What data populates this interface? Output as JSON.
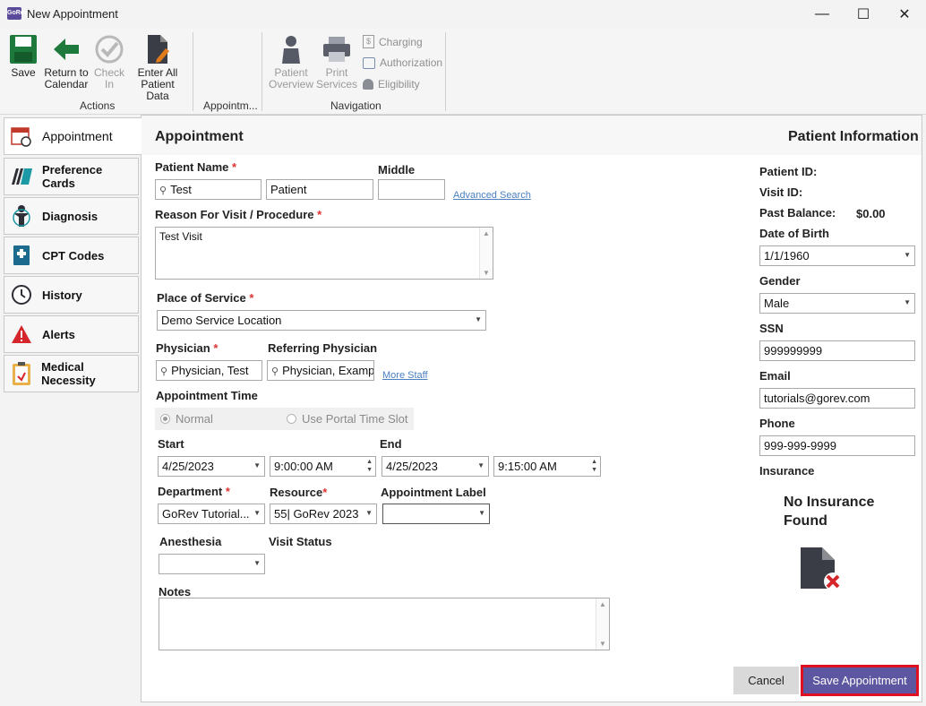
{
  "window": {
    "title": "New Appointment",
    "app_icon_text": "GoRev",
    "minimize_glyph": "—",
    "maximize_glyph": "☐",
    "close_glyph": "✕"
  },
  "ribbon": {
    "save": "Save",
    "return_line1": "Return to",
    "return_line2": "Calendar",
    "checkin_line1": "Check",
    "checkin_line2": "In",
    "enter_line1": "Enter All",
    "enter_line2": "Patient Data",
    "group_actions": "Actions",
    "group_appointment": "Appointm...",
    "overview_line1": "Patient",
    "overview_line2": "Overview",
    "print_line1": "Print",
    "print_line2": "Services",
    "charging": "Charging",
    "authorization": "Authorization",
    "eligibility": "Eligibility",
    "group_navigation": "Navigation"
  },
  "tabs": [
    {
      "label": "Appointment",
      "icon": "calendar-clock-icon"
    },
    {
      "label": "Preference Cards",
      "icon": "cards-icon"
    },
    {
      "label": "Diagnosis",
      "icon": "body-icon"
    },
    {
      "label": "CPT Codes",
      "icon": "book-icon"
    },
    {
      "label": "History",
      "icon": "clock-icon"
    },
    {
      "label": "Alerts",
      "icon": "warning-icon"
    },
    {
      "label": "Medical Necessity",
      "icon": "clipboard-icon"
    }
  ],
  "form": {
    "section_title": "Appointment",
    "patient_name_label": "Patient Name",
    "middle_label": "Middle",
    "first_name": "Test",
    "last_name": "Patient",
    "middle": "",
    "advanced_search": "Advanced Search",
    "reason_label": "Reason For Visit / Procedure",
    "reason_value": "Test Visit",
    "place_label": "Place of Service",
    "place_value": "Demo Service Location",
    "physician_label": "Physician",
    "physician_value": "Physician, Test",
    "referring_label": "Referring Physician",
    "referring_value": "Physician, Examp",
    "more_staff": "More Staff",
    "appt_time_label": "Appointment Time",
    "normal": "Normal",
    "portal": "Use Portal Time Slot",
    "start_label": "Start",
    "end_label": "End",
    "start_date": "4/25/2023",
    "start_time": "9:00:00 AM",
    "end_date": "4/25/2023",
    "end_time": "9:15:00 AM",
    "department_label": "Department",
    "department_value": "GoRev Tutorial...",
    "resource_label": "Resource",
    "resource_value": "55| GoRev 2023",
    "appt_label_label": "Appointment Label",
    "appt_label_value": "",
    "anesthesia_label": "Anesthesia",
    "anesthesia_value": "",
    "visit_status_label": "Visit Status",
    "notes_label": "Notes",
    "notes_value": "",
    "required_mark": "*"
  },
  "patient_info": {
    "title": "Patient Information",
    "patient_id_label": "Patient ID:",
    "visit_id_label": "Visit ID:",
    "past_balance_label": "Past Balance:",
    "past_balance_value": "$0.00",
    "dob_label": "Date of Birth",
    "dob_value": "1/1/1960",
    "gender_label": "Gender",
    "gender_value": "Male",
    "ssn_label": "SSN",
    "ssn_value": "999999999",
    "email_label": "Email",
    "email_value": "tutorials@gorev.com",
    "phone_label": "Phone",
    "phone_value": "999-999-9999",
    "insurance_label": "Insurance",
    "no_insurance_line1": "No Insurance",
    "no_insurance_line2": "Found"
  },
  "buttons": {
    "cancel": "Cancel",
    "save_appointment": "Save Appointment"
  },
  "colors": {
    "accent_purple": "#5d56a0",
    "highlight_red": "#e0101e",
    "green_icon": "#1e7a3c",
    "link_blue": "#4a7fc0"
  }
}
